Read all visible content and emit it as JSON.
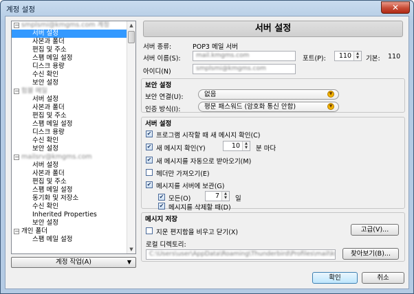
{
  "window": {
    "title": "계정 설정",
    "close": "✕"
  },
  "tree": {
    "scroll_up": "▲",
    "scroll_down": "▼",
    "accounts": [
      {
        "name": "smplsmi@kmgms.com 계정",
        "expanded": true,
        "children": [
          "서버 설정",
          "사본과 폴더",
          "편집 및 주소",
          "스팸 메일 설정",
          "디스크 용량",
          "수신 확인",
          "보안 설정"
        ]
      },
      {
        "name": "험블 메일",
        "expanded": true,
        "children": [
          "서버 설정",
          "사본과 폴더",
          "편집 및 주소",
          "스팸 메일 설정",
          "디스크 용량",
          "수신 확인",
          "보안 설정"
        ]
      },
      {
        "name": "mailsrv@kmgms.com",
        "expanded": true,
        "children": [
          "서버 설정",
          "사본과 폴더",
          "편집 및 주소",
          "스팸 메일 설정",
          "동기화 및 저장소",
          "수신 확인",
          "Inherited Properties",
          "보안 설정"
        ]
      },
      {
        "name": "개인 폴더",
        "expanded": true,
        "plain": true,
        "children": [
          "스팸 메일 설정"
        ]
      }
    ],
    "selected": "0-0"
  },
  "account_actions": {
    "label": "계정 작업(A)",
    "arrow": "▼"
  },
  "server": {
    "header": "서버 설정",
    "type_label": "서버 종류:",
    "type_value": "POP3 메일 서버",
    "name_label": "서버 이름(S):",
    "name_value": "mail.kmgms.com",
    "port_label": "포트(P):",
    "port_value": "110",
    "default_label": "기본:",
    "default_value": "110",
    "id_label": "아이디(N)",
    "id_value": "smplsmi@kmgms.com"
  },
  "security": {
    "title": "보안 설정",
    "conn_label": "보안 연결(U):",
    "conn_value": "없음",
    "auth_label": "인증 방식(I):",
    "auth_value": "평문 패스워드 (암호화 통신 안함)"
  },
  "settings": {
    "title": "서버 설정",
    "check_startup": "프로그램 시작할 때 새 메시지 확인(C)",
    "check_every": "새 메시지 확인(Y)",
    "every_value": "10",
    "every_unit": "분 마다",
    "auto_download": "새 메시지를 자동으로 받아오기(M)",
    "headers_only": "헤더만 가져오기(E)",
    "leave_on_server": "메시지를 서버에 보관(G)",
    "max_days": "모든(O)",
    "days_value": "7",
    "days_unit": "일",
    "delete_until": "메시지를 삭제할 때(D)"
  },
  "storage": {
    "title": "메시지 저장",
    "empty_trash": "지운 편지함을 비우고 닫기(X)",
    "advanced": "고급(V)...",
    "local_dir_label": "로컬 디렉토리:",
    "local_dir_value": "C:\\Users\\user\\AppData\\Roaming\\Thunderbird\\Profiles\\mail\\kmgms",
    "browse": "찾아보기(B)..."
  },
  "footer": {
    "ok": "확인",
    "cancel": "취소"
  },
  "check_mark": "✔"
}
